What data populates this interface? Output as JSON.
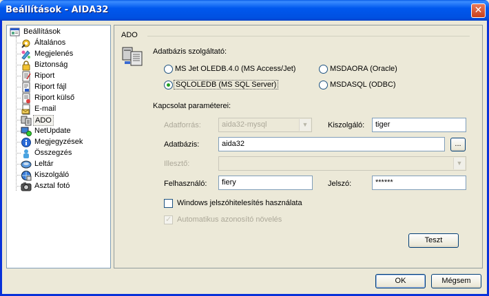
{
  "window": {
    "title": "Beállítások - AIDA32",
    "close_glyph": "✕"
  },
  "tree": {
    "root": "Beállítások",
    "items": [
      {
        "label": "Általános",
        "icon": "general-icon"
      },
      {
        "label": "Megjelenés",
        "icon": "appearance-icon"
      },
      {
        "label": "Biztonság",
        "icon": "lock-icon"
      },
      {
        "label": "Riport",
        "icon": "report-icon"
      },
      {
        "label": "Riport fájl",
        "icon": "report-file-icon"
      },
      {
        "label": "Riport külső",
        "icon": "report-external-icon"
      },
      {
        "label": "E-mail",
        "icon": "email-icon"
      },
      {
        "label": "ADO",
        "icon": "database-icon",
        "selected": true
      },
      {
        "label": "NetUpdate",
        "icon": "netupdate-icon"
      },
      {
        "label": "Megjegyzések",
        "icon": "info-icon"
      },
      {
        "label": "Összegzés",
        "icon": "summary-icon"
      },
      {
        "label": "Leltár",
        "icon": "inventory-icon"
      },
      {
        "label": "Kiszolgáló",
        "icon": "server-icon"
      },
      {
        "label": "Asztal fotó",
        "icon": "desktop-photo-icon"
      }
    ]
  },
  "ado": {
    "group_title": "ADO",
    "provider_label": "Adatbázis szolgáltató:",
    "providers": [
      {
        "label": "MS Jet OLEDB.4.0 (MS Access/Jet)",
        "checked": false
      },
      {
        "label": "MSDAORA (Oracle)",
        "checked": false
      },
      {
        "label": "SQLOLEDB (MS SQL Server)",
        "checked": true
      },
      {
        "label": "MSDASQL (ODBC)",
        "checked": false
      }
    ],
    "conn_label": "Kapcsolat paraméterei:",
    "datasource_label": "Adatforrás:",
    "datasource_value": "aida32-mysql",
    "server_label": "Kiszolgáló:",
    "server_value": "tiger",
    "database_label": "Adatbázis:",
    "database_value": "aida32",
    "browse_label": "...",
    "driver_label": "Illesztő:",
    "driver_value": "",
    "user_label": "Felhasználó:",
    "user_value": "fiery",
    "password_label": "Jelszó:",
    "password_value": "******",
    "windows_auth_label": "Windows jelszóhitelesítés használata",
    "windows_auth_checked": false,
    "auto_id_label": "Automatikus azonosító növelés",
    "auto_id_checked": true,
    "test_button": "Teszt"
  },
  "footer": {
    "ok": "OK",
    "cancel": "Mégsem"
  },
  "colors": {
    "titlebar": "#0058ee",
    "radio_dot": "#21a121",
    "border": "#7f9db9"
  }
}
